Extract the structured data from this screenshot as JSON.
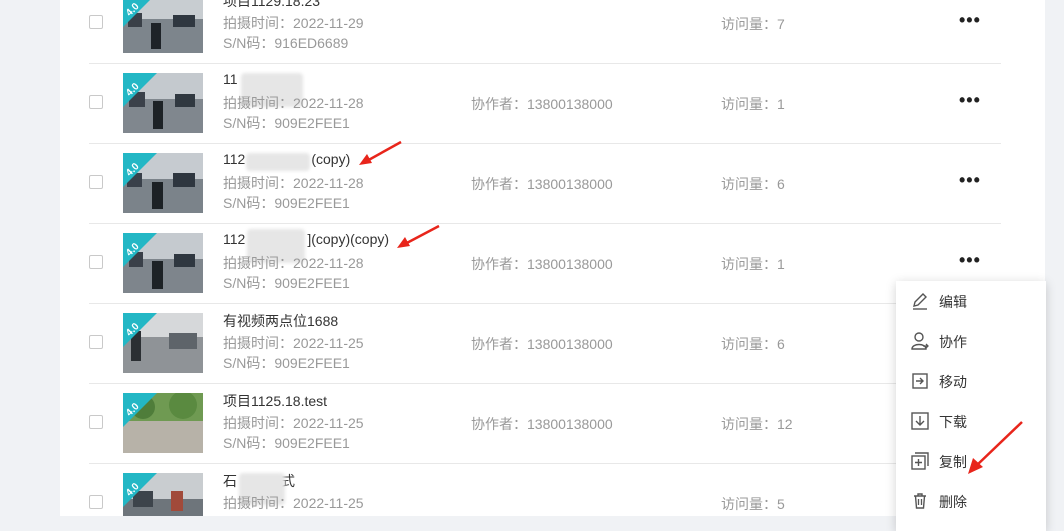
{
  "list": {
    "labels": {
      "shoot_time": "拍摄时间：",
      "sn": "S/N码：",
      "collaborator": "协作者：",
      "visits": "访问量：",
      "more": "•••",
      "badge": "4.0"
    },
    "rows": [
      {
        "title": "项目1129.18.23",
        "date": "2022-11-29",
        "sn": "916ED6689",
        "collaborator": "",
        "visits": "7"
      },
      {
        "title": "11",
        "date": "2022-11-28",
        "sn": "909E2FEE1",
        "collaborator": "13800138000",
        "visits": "1"
      },
      {
        "title": "112",
        "title_suffix": "(copy)",
        "date": "2022-11-28",
        "sn": "909E2FEE1",
        "collaborator": "13800138000",
        "visits": "6"
      },
      {
        "title": "112",
        "title_suffix": "](copy)(copy)",
        "date": "2022-11-28",
        "sn": "909E2FEE1",
        "collaborator": "13800138000",
        "visits": "1"
      },
      {
        "title": "有视频两点位1688",
        "date": "2022-11-25",
        "sn": "909E2FEE1",
        "collaborator": "13800138000",
        "visits": "6"
      },
      {
        "title": "项目1125.18.test",
        "date": "2022-11-25",
        "sn": "909E2FEE1",
        "collaborator": "13800138000",
        "visits": "12"
      },
      {
        "title": "石",
        "title_suffix": "式",
        "date": "2022-11-25",
        "sn": "",
        "collaborator": "",
        "visits": "5"
      }
    ]
  },
  "context_menu": {
    "items": [
      {
        "label": "编辑",
        "icon": "edit-icon"
      },
      {
        "label": "协作",
        "icon": "collaborate-icon"
      },
      {
        "label": "移动",
        "icon": "move-icon"
      },
      {
        "label": "下载",
        "icon": "download-icon"
      },
      {
        "label": "复制",
        "icon": "copy-icon"
      },
      {
        "label": "删除",
        "icon": "delete-icon"
      }
    ]
  },
  "colors": {
    "badge": "#23b7c5",
    "annotation_arrow": "#e8251b"
  }
}
